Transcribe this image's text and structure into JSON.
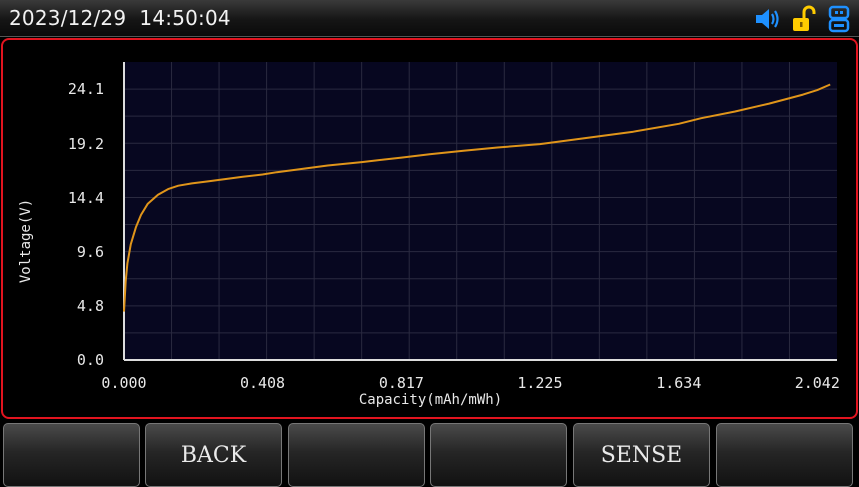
{
  "status_bar": {
    "date": "2023/12/29",
    "time": "14:50:04",
    "icons": [
      "speaker-icon",
      "unlocked-padlock-icon",
      "usb-device-icon"
    ],
    "icon_colors": {
      "speaker": "#1e90ff",
      "lock": "#ffcc00",
      "usb": "#1e90ff"
    }
  },
  "panel": {
    "border_color": "#e2141f"
  },
  "chart_data": {
    "type": "line",
    "xlabel": "Capacity(mAh/mWh)",
    "ylabel": "Voltage(V)",
    "xlim": [
      0,
      2.1
    ],
    "ylim": [
      0,
      26.5
    ],
    "x_ticks": [
      "0.000",
      "0.408",
      "0.817",
      "1.225",
      "1.634",
      "2.042"
    ],
    "x_tick_values": [
      0,
      0.408,
      0.817,
      1.225,
      1.634,
      2.042
    ],
    "y_ticks": [
      "0.0",
      "4.8",
      "9.6",
      "14.4",
      "19.2",
      "24.1"
    ],
    "y_tick_values": [
      0,
      4.8,
      9.6,
      14.4,
      19.2,
      24.1
    ],
    "grid": true,
    "line_color": "#e0951a",
    "background_color": "#070720",
    "series": [
      {
        "x": [
          0.0,
          0.005,
          0.01,
          0.02,
          0.035,
          0.05,
          0.07,
          0.1,
          0.13,
          0.16,
          0.2,
          0.25,
          0.3,
          0.35,
          0.408,
          0.45,
          0.5,
          0.6,
          0.7,
          0.817,
          0.9,
          1.0,
          1.1,
          1.225,
          1.3,
          1.4,
          1.5,
          1.634,
          1.7,
          1.8,
          1.9,
          2.0,
          2.042,
          2.08
        ],
        "y": [
          4.3,
          7.0,
          8.6,
          10.3,
          11.8,
          12.9,
          13.9,
          14.7,
          15.2,
          15.5,
          15.7,
          15.9,
          16.1,
          16.3,
          16.5,
          16.7,
          16.9,
          17.3,
          17.6,
          18.0,
          18.3,
          18.6,
          18.9,
          19.2,
          19.5,
          19.9,
          20.3,
          21.0,
          21.5,
          22.1,
          22.8,
          23.6,
          24.0,
          24.5
        ]
      }
    ]
  },
  "buttons": [
    {
      "id": "softkey-1",
      "label": ""
    },
    {
      "id": "softkey-back",
      "label": "BACK"
    },
    {
      "id": "softkey-3",
      "label": ""
    },
    {
      "id": "softkey-4",
      "label": ""
    },
    {
      "id": "softkey-sense",
      "label": "SENSE"
    },
    {
      "id": "softkey-6",
      "label": ""
    }
  ]
}
